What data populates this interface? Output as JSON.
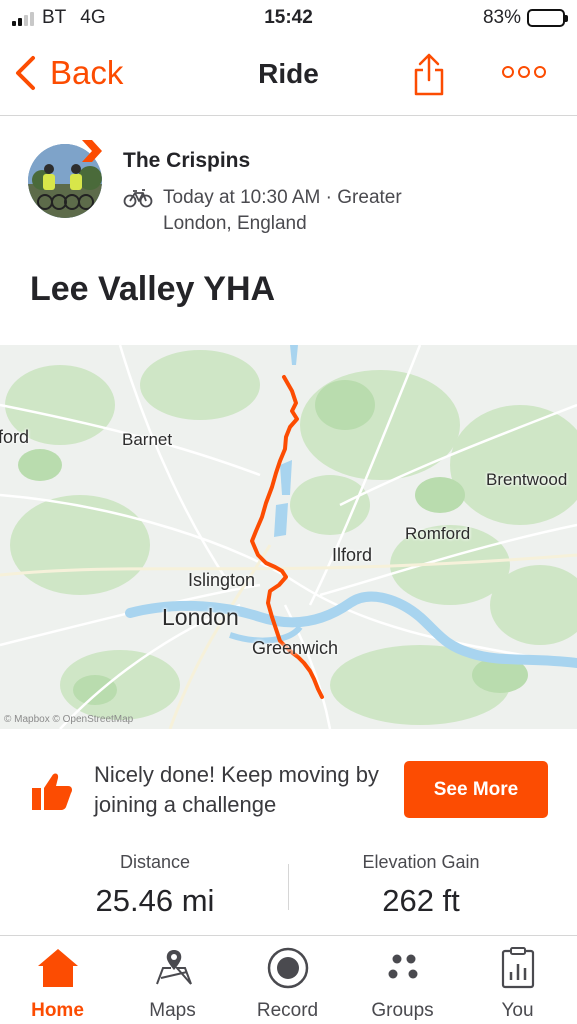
{
  "status_bar": {
    "carrier": "BT",
    "network": "4G",
    "time": "15:42",
    "battery": "83%",
    "battery_level": 0.83
  },
  "nav": {
    "back_label": "Back",
    "title": "Ride"
  },
  "athlete": {
    "name": "The Crispins",
    "meta": "Today at 10:30 AM · Greater London, England",
    "activity_icon": "bike-icon"
  },
  "activity": {
    "title": "Lee Valley YHA"
  },
  "map": {
    "labels": {
      "ford": "ford",
      "barnet": "Barnet",
      "brentwood": "Brentwood",
      "romford": "Romford",
      "ilford": "Ilford",
      "islington": "Islington",
      "london": "London",
      "greenwich": "Greenwich"
    },
    "attribution": "© Mapbox © OpenStreetMap",
    "route_color": "#fc4c02"
  },
  "challenge": {
    "text": "Nicely done! Keep moving by joining a challenge",
    "button_label": "See More"
  },
  "stats": [
    {
      "label": "Distance",
      "value": "25.46 mi"
    },
    {
      "label": "Elevation Gain",
      "value": "262 ft"
    }
  ],
  "tabs": [
    {
      "label": "Home",
      "icon": "home-icon",
      "active": true
    },
    {
      "label": "Maps",
      "icon": "maps-icon"
    },
    {
      "label": "Record",
      "icon": "record-icon"
    },
    {
      "label": "Groups",
      "icon": "groups-icon"
    },
    {
      "label": "You",
      "icon": "you-icon"
    }
  ],
  "colors": {
    "accent": "#fc4c02",
    "text": "#242428"
  }
}
